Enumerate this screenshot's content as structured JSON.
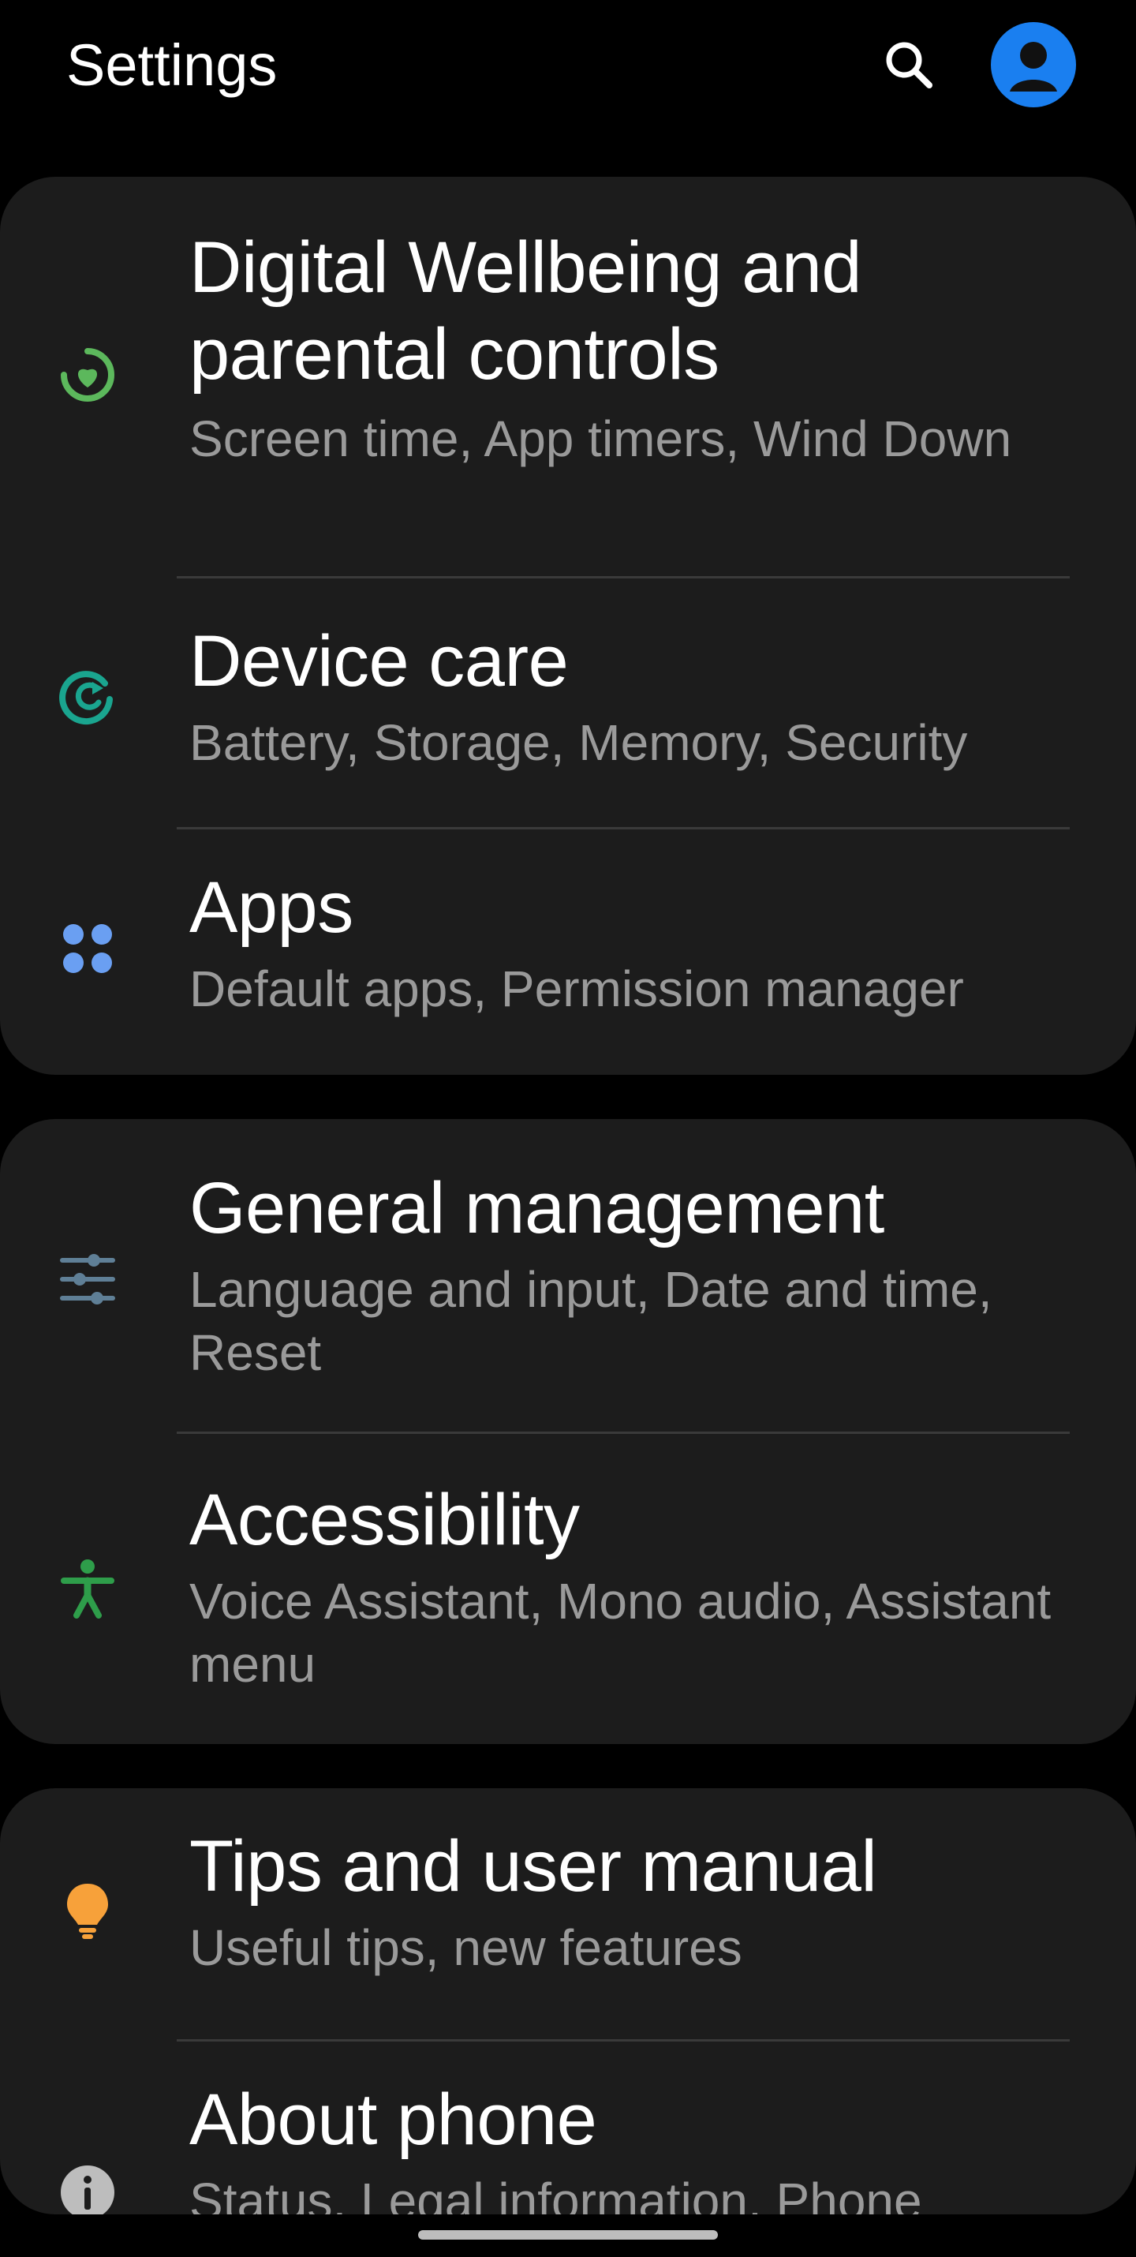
{
  "header": {
    "title": "Settings"
  },
  "colors": {
    "background": "#000000",
    "card": "#1c1c1c",
    "divider": "#3a3a3a",
    "subtext": "#9a9a9a",
    "profile": "#1a7ff0",
    "wellbeing_icon": "#5cb85c",
    "device_care_icon": "#1aa58f",
    "apps_icon": "#6a9ff2",
    "general_icon": "#5f7f96",
    "accessibility_icon": "#2e9d4a",
    "tips_icon": "#f7a13a",
    "about_icon": "#bdbdbd"
  },
  "groups": [
    {
      "items": [
        {
          "icon": "digital-wellbeing-icon",
          "title": "Digital Wellbeing and parental controls",
          "subtitle": "Screen time, App timers, Wind Down"
        },
        {
          "icon": "device-care-icon",
          "title": "Device care",
          "subtitle": "Battery, Storage, Memory, Security"
        },
        {
          "icon": "apps-icon",
          "title": "Apps",
          "subtitle": "Default apps, Permission manager"
        }
      ]
    },
    {
      "items": [
        {
          "icon": "general-management-icon",
          "title": "General management",
          "subtitle": "Language and input, Date and time, Reset"
        },
        {
          "icon": "accessibility-icon",
          "title": "Accessibility",
          "subtitle": "Voice Assistant, Mono audio, Assistant menu"
        }
      ]
    },
    {
      "items": [
        {
          "icon": "tips-lightbulb-icon",
          "title": "Tips and user manual",
          "subtitle": "Useful tips, new features"
        },
        {
          "icon": "info-icon",
          "title": "About phone",
          "subtitle": "Status, Legal information, Phone"
        }
      ]
    }
  ]
}
